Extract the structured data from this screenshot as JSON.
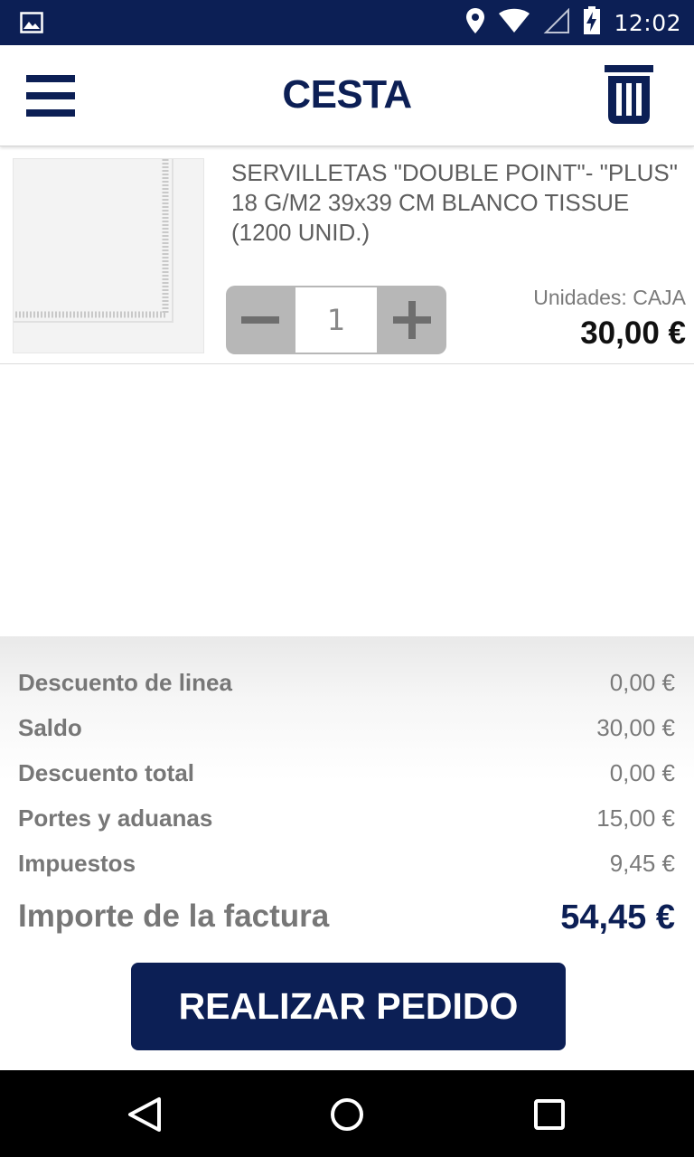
{
  "status_bar": {
    "time": "12:02",
    "icons": [
      "image-icon",
      "location-icon",
      "wifi-icon",
      "signal-icon",
      "battery-charging-icon"
    ]
  },
  "header": {
    "title": "CESTA",
    "menu_icon": "hamburger-menu-icon",
    "trash_icon": "trash-icon",
    "color": "#0c1f55"
  },
  "cart": {
    "items": [
      {
        "name": "SERVILLETAS \"DOUBLE POINT\"- \"PLUS\" 18 G/M2 39x39 CM BLANCO TISSUE (1200 UNID.)",
        "quantity": "1",
        "units": "Unidades: CAJA",
        "price": "30,00 €"
      }
    ]
  },
  "summary": {
    "rows": [
      {
        "label": "Descuento de linea",
        "value": "0,00 €"
      },
      {
        "label": "Saldo",
        "value": "30,00 €"
      },
      {
        "label": "Descuento total",
        "value": "0,00 €"
      },
      {
        "label": "Portes y aduanas",
        "value": "15,00 €"
      },
      {
        "label": "Impuestos",
        "value": "9,45 €"
      }
    ],
    "total": {
      "label": "Importe de la factura",
      "value": "54,45 €"
    },
    "order_button": "REALIZAR PEDIDO"
  },
  "nav_bar": {
    "icons": [
      "back-icon",
      "home-icon",
      "recents-icon"
    ]
  }
}
